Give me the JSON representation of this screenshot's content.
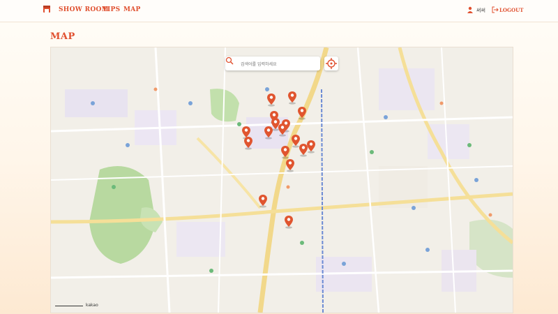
{
  "header": {
    "logo_icon": "house-icon",
    "nav": [
      "SHOW ROOM",
      "TIPS",
      "MAP"
    ],
    "user_icon": "user-icon",
    "username": "써써",
    "logout_icon": "logout-icon",
    "logout_label": "LOGOUT"
  },
  "page": {
    "title": "MAP"
  },
  "map": {
    "search_placeholder": "검색어를 입력하세요",
    "search_icon": "magnifier-icon",
    "locate_icon": "crosshair-icon",
    "scale_label": "kakao",
    "marker_color": "#e0552f",
    "marker_count": 17
  },
  "colors": {
    "accent": "#e0502f",
    "background": "#fff6ea"
  }
}
